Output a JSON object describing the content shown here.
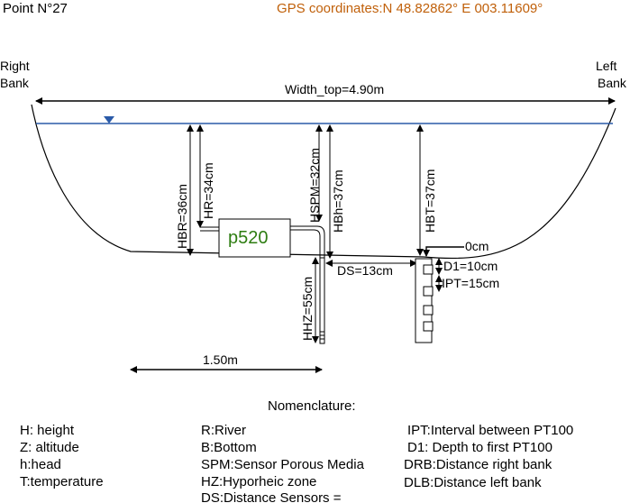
{
  "header": {
    "point": "Point N°27",
    "gps": "GPS coordinates:N 48.82862° E 003.11609°"
  },
  "banks": {
    "right_line1": "Right",
    "right_line2": "Bank",
    "left_line1": "Left",
    "left_line2": "Bank"
  },
  "labels": {
    "width_top": "Width_top=4.90m",
    "hbr": "HBR=36cm",
    "hr": "HR=34cm",
    "hspm": "HSPM=32cm",
    "hbh": "HBh=37cm",
    "hbt": "HBT=37cm",
    "hhz": "HHZ=55cm",
    "ds": "DS=13cm",
    "zero": "0cm",
    "d1": "D1=10cm",
    "ipt": "IPT=15cm",
    "p520": "p520",
    "scale": "1.50m"
  },
  "nomenclature": {
    "title": "Nomenclature:",
    "col1": [
      "H: height",
      "Z: altitude",
      "h:head",
      "T:temperature"
    ],
    "col2": [
      "R:River",
      "B:Bottom",
      "SPM:Sensor Porous Media",
      "HZ:Hyporheic zone",
      "DS:Distance Sensors ="
    ],
    "col3": [
      "IPT:Interval between PT100",
      "D1: Depth to first PT100",
      "DRB:Distance right bank",
      "DLB:Distance left bank"
    ]
  },
  "colors": {
    "gps": "#c0600a",
    "water": "#2a5aa8",
    "p520": "#2e7d12"
  }
}
